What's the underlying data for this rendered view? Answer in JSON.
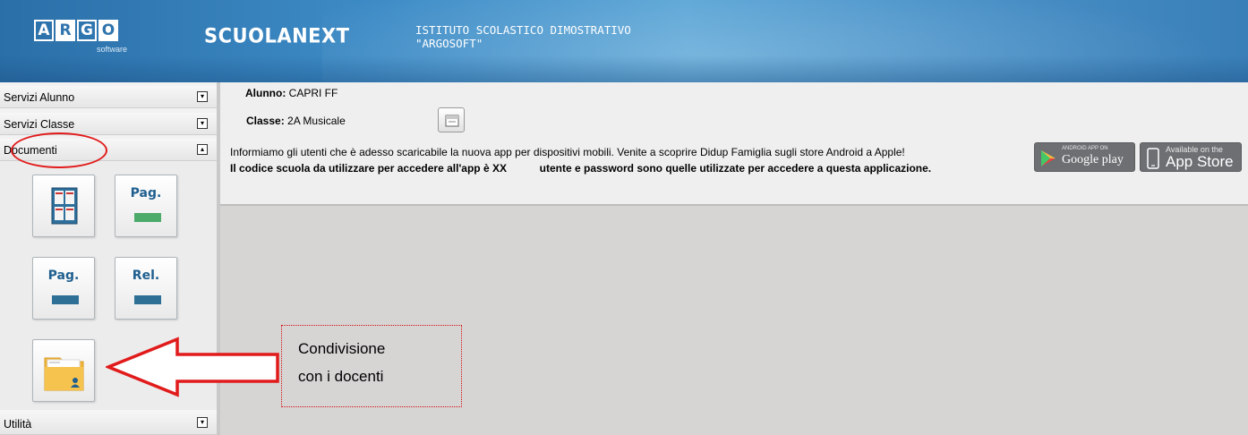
{
  "header": {
    "logo_letters": [
      "A",
      "R",
      "G",
      "O"
    ],
    "logo_subtitle": "software",
    "brand": "SCUOLANEXT",
    "school_line1": "ISTITUTO SCOLASTICO DIMOSTRATIVO",
    "school_line2": "\"ARGOSOFT\""
  },
  "sidebar": {
    "items": [
      {
        "label": "Servizi Alunno",
        "toggle": "▾"
      },
      {
        "label": "Servizi Classe",
        "toggle": "▾"
      },
      {
        "label": "Documenti",
        "toggle": "▴"
      },
      {
        "label": "Utilità",
        "toggle": "▾"
      }
    ],
    "tiles": [
      {
        "icon": "document-grid-icon",
        "label": ""
      },
      {
        "icon": "pag-green-icon",
        "label": "Pag."
      },
      {
        "icon": "pag-blue-icon",
        "label": "Pag."
      },
      {
        "icon": "rel-blue-icon",
        "label": "Rel."
      },
      {
        "icon": "shared-folder-user-icon",
        "label": ""
      }
    ]
  },
  "student": {
    "alunno_label": "Alunno:",
    "alunno_value": "CAPRI FF",
    "classe_label": "Classe:",
    "classe_value": "2A Musicale"
  },
  "notice": {
    "line1": "Informiamo gli utenti che è adesso scaricabile la nuova app per dispositivi mobili. Venite a scoprire Didup Famiglia sugli store Android a Apple!",
    "line2": "Il codice scuola da utilizzare per accedere all'app è XX           utente e password sono quelle utilizzate per accedere a questa applicazione."
  },
  "stores": {
    "google_small": "ANDROID APP ON",
    "google_big": "Google play",
    "apple_small": "Available on the",
    "apple_big": "App Store"
  },
  "callout": {
    "line1": "Condivisione",
    "line2": "con i docenti"
  },
  "colors": {
    "header_blue": "#3d8bc6",
    "annotation_red": "#e11b1b",
    "tile_green": "#4caa6b",
    "tile_blue": "#2e6f95"
  }
}
